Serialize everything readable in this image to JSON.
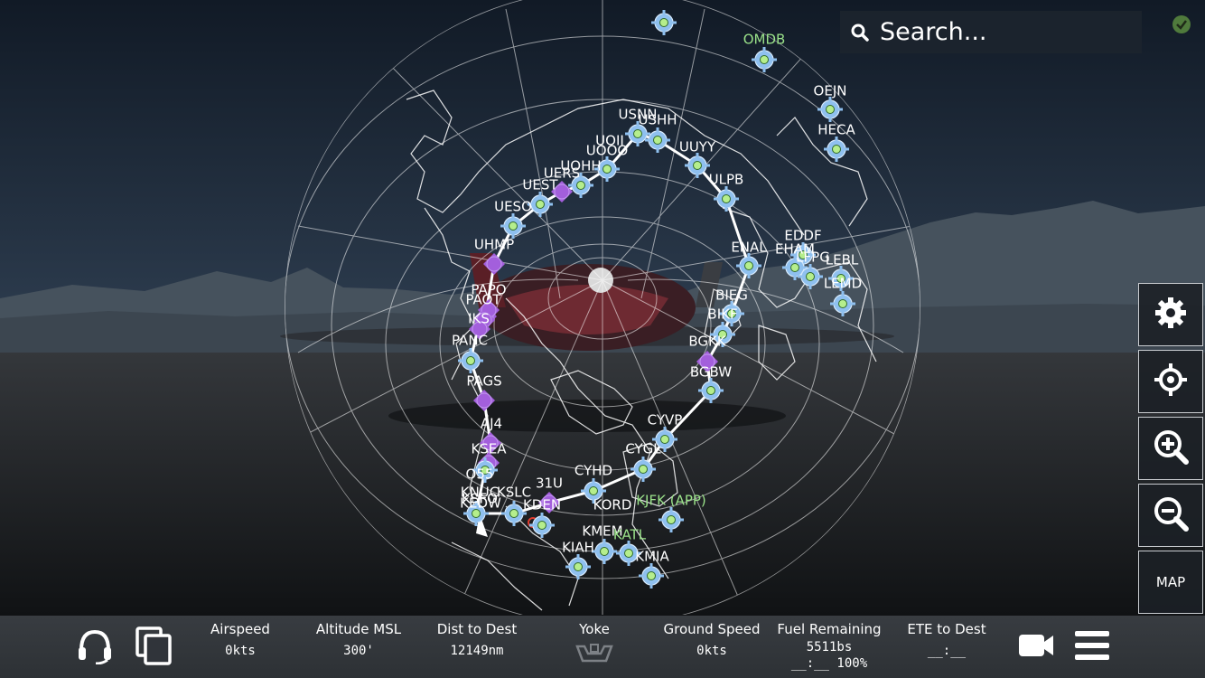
{
  "search": {
    "placeholder": "Search..."
  },
  "side_buttons": {
    "map_label": "MAP"
  },
  "waypoints": [
    {
      "id": "OMDB",
      "color": "green"
    },
    {
      "id": "OEJN"
    },
    {
      "id": "HECA"
    },
    {
      "id": "USNN"
    },
    {
      "id": "USHH"
    },
    {
      "id": "UOII"
    },
    {
      "id": "UOOO"
    },
    {
      "id": "UUYY"
    },
    {
      "id": "UOHH"
    },
    {
      "id": "UERS"
    },
    {
      "id": "UEST"
    },
    {
      "id": "ULPB"
    },
    {
      "id": "UESO"
    },
    {
      "id": "EDDF"
    },
    {
      "id": "EHAM"
    },
    {
      "id": "LFPG"
    },
    {
      "id": "LEBL"
    },
    {
      "id": "LEMD"
    },
    {
      "id": "UHMP"
    },
    {
      "id": "ENAL"
    },
    {
      "id": "PAPO"
    },
    {
      "id": "PAOT"
    },
    {
      "id": "IKS"
    },
    {
      "id": "BIEG"
    },
    {
      "id": "BIKF"
    },
    {
      "id": "PANC"
    },
    {
      "id": "BGKK"
    },
    {
      "id": "BGBW"
    },
    {
      "id": "PAGS"
    },
    {
      "id": "AJ4"
    },
    {
      "id": "CYVP"
    },
    {
      "id": "KSEA"
    },
    {
      "id": "CYGL"
    },
    {
      "id": "O55"
    },
    {
      "id": "CYHD"
    },
    {
      "id": "31U"
    },
    {
      "id": "KSLC"
    },
    {
      "id": "KNUC"
    },
    {
      "id": "KSFO"
    },
    {
      "id": "KEDW"
    },
    {
      "id": "KDEN"
    },
    {
      "id": "KJFK (APP)",
      "color": "green"
    },
    {
      "id": "KORD"
    },
    {
      "id": "KMEM"
    },
    {
      "id": "KATL",
      "color": "green"
    },
    {
      "id": "KIAH"
    },
    {
      "id": "KMIA"
    }
  ],
  "bottom_bar": {
    "airspeed": {
      "label": "Airspeed",
      "value": "0kts"
    },
    "altitude": {
      "label": "Altitude MSL",
      "value": "300'"
    },
    "dist": {
      "label": "Dist to Dest",
      "value": "12149nm"
    },
    "yoke": {
      "label": "Yoke"
    },
    "ground_speed": {
      "label": "Ground Speed",
      "value": "0kts"
    },
    "fuel": {
      "label": "Fuel Remaining",
      "value": "5511bs",
      "value2": "__:__ 100%"
    },
    "ete": {
      "label": "ETE to Dest",
      "value": "__:__"
    }
  },
  "colors": {
    "accent": "#8fc0ef",
    "purple": "#a35fdc",
    "green_label": "#9be38a",
    "route": "#ffffff"
  },
  "icons": [
    "search-icon",
    "check-icon",
    "gear-icon",
    "crosshair-icon",
    "zoom-in-icon",
    "zoom-out-icon",
    "headset-icon",
    "copy-icon",
    "yoke-icon",
    "camera-icon",
    "menu-icon",
    "airplane-icon"
  ]
}
